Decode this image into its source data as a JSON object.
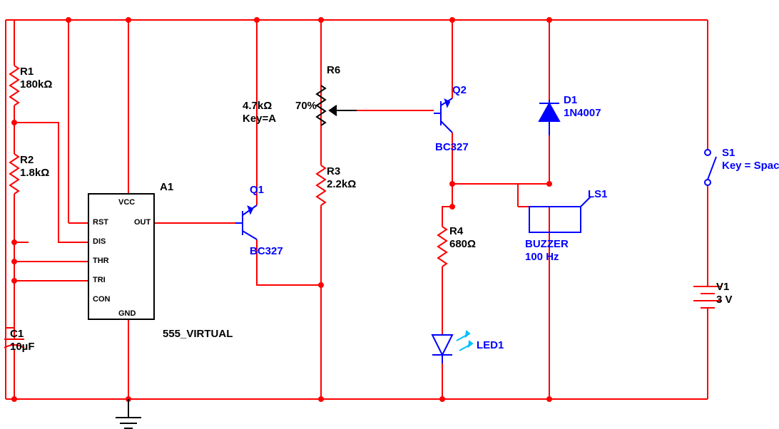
{
  "components": {
    "R1": {
      "name": "R1",
      "value": "180kΩ"
    },
    "R2": {
      "name": "R2",
      "value": "1.8kΩ"
    },
    "R3": {
      "name": "R3",
      "value": "2.2kΩ"
    },
    "R4": {
      "name": "R4",
      "value": "680Ω"
    },
    "R6": {
      "name": "R6",
      "value": "4.7kΩ",
      "key": "Key=A",
      "percent": "70%"
    },
    "C1": {
      "name": "C1",
      "value": "10µF"
    },
    "A1": {
      "name": "A1",
      "type": "555_VIRTUAL",
      "pins": {
        "vcc": "VCC",
        "rst": "RST",
        "out": "OUT",
        "dis": "DIS",
        "thr": "THR",
        "tri": "TRI",
        "con": "CON",
        "gnd": "GND"
      }
    },
    "Q1": {
      "name": "Q1",
      "part": "BC327"
    },
    "Q2": {
      "name": "Q2",
      "part": "BC327"
    },
    "D1": {
      "name": "D1",
      "part": "1N4007"
    },
    "LED1": {
      "name": "LED1"
    },
    "LS1": {
      "name": "LS1",
      "type": "BUZZER",
      "freq": "100 Hz"
    },
    "S1": {
      "name": "S1",
      "key": "Key = Space"
    },
    "V1": {
      "name": "V1",
      "value": "3 V"
    }
  }
}
